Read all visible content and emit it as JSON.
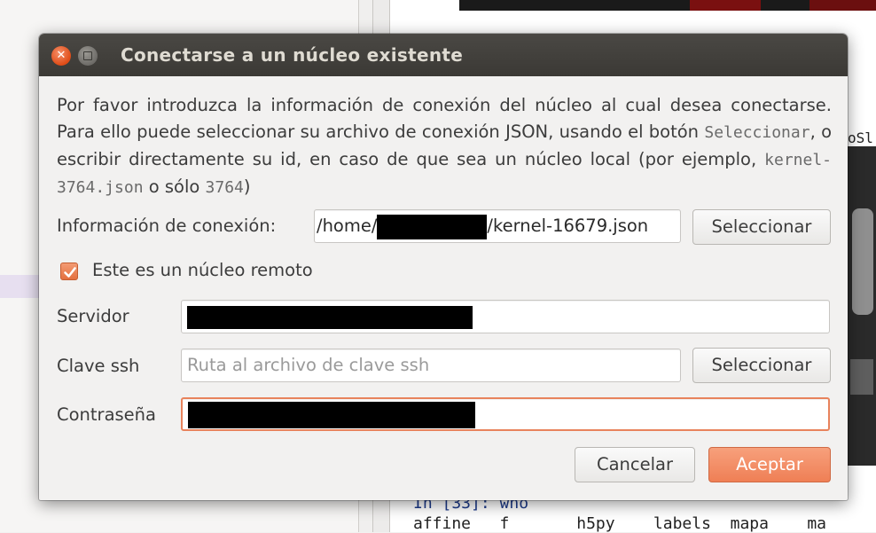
{
  "dialog": {
    "title": "Conectarse a un núcleo existente",
    "description": {
      "part1": "Por favor introduzca la información de conexión del núcleo al cual desea conectarse. Para ello puede seleccionar su archivo de conexión JSON, usando el botón ",
      "code1": "Seleccionar",
      "part2": ", o escribir directamente su id, en caso de que sea un núcleo local (por ejemplo, ",
      "code2": "kernel-3764.json",
      "part3": " o sólo ",
      "code3": "3764",
      "part4": ")"
    },
    "connection_info": {
      "label": "Información de conexión:",
      "value_prefix": "/home/",
      "value_suffix": "/kernel-16679.json",
      "browse_label": "Seleccionar"
    },
    "remote": {
      "label": "Este es un núcleo remoto",
      "checked": true
    },
    "server": {
      "label": "Servidor"
    },
    "ssh_key": {
      "label": "Clave ssh",
      "placeholder": "Ruta al archivo de clave ssh",
      "browse_label": "Seleccionar"
    },
    "password": {
      "label": "Contraseña"
    },
    "cancel_label": "Cancelar",
    "accept_label": "Aceptar"
  },
  "background": {
    "partial_text": "oSl",
    "console_line1": "In [33]: who",
    "console_line2": "affine   f       h5py    labels  mapa    ma"
  },
  "colors": {
    "accent": "#ef7f55",
    "titlebar": "#3c3b37",
    "close_button": "#df4b16"
  }
}
